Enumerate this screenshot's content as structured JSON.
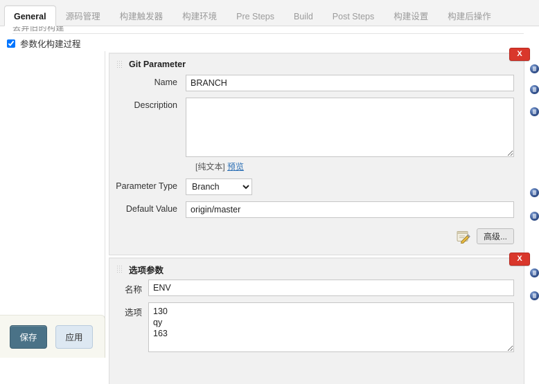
{
  "tabs": [
    {
      "label": "General",
      "active": true
    },
    {
      "label": "源码管理",
      "active": false
    },
    {
      "label": "构建触发器",
      "active": false
    },
    {
      "label": "构建环境",
      "active": false
    },
    {
      "label": "Pre Steps",
      "active": false
    },
    {
      "label": "Build",
      "active": false
    },
    {
      "label": "Post Steps",
      "active": false
    },
    {
      "label": "构建设置",
      "active": false
    },
    {
      "label": "构建后操作",
      "active": false
    }
  ],
  "clipped_row": {
    "text": "丢弃旧的构建"
  },
  "parameterize": {
    "label": "参数化构建过程",
    "checked": true
  },
  "git_parameter": {
    "title": "Git Parameter",
    "close_label": "X",
    "name_label": "Name",
    "name_value": "BRANCH",
    "description_label": "Description",
    "description_value": "",
    "description_placeholder": "",
    "plaintext_note": "[纯文本]",
    "preview_link": "预览",
    "parameter_type_label": "Parameter Type",
    "parameter_type_value": "Branch",
    "parameter_type_options": [
      "Branch"
    ],
    "default_value_label": "Default Value",
    "default_value": "origin/master",
    "advanced_label": "高级..."
  },
  "choice_parameter": {
    "title": "选项参数",
    "close_label": "X",
    "name_label": "名称",
    "name_value": "ENV",
    "choices_label": "选项",
    "choices_value": "130\nqy\n163"
  },
  "actions": {
    "save_label": "保存",
    "apply_label": "应用"
  },
  "colors": {
    "save_button": "#4a7287",
    "apply_button": "#dde8f2",
    "close_button": "#d9372b",
    "panel_bg": "#f1f1f1",
    "link": "#2b6fb5"
  }
}
